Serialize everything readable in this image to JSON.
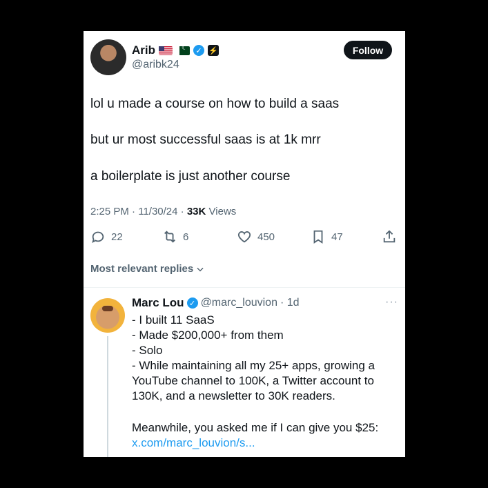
{
  "tweet": {
    "author_name": "Arib",
    "author_handle": "@aribk24",
    "follow_label": "Follow",
    "lines": [
      "lol u made a course on how to build a saas",
      "but ur most successful saas is at 1k mrr",
      "a boilerplate is just another course"
    ],
    "time": "2:25 PM",
    "date": "11/30/24",
    "views_count": "33K",
    "views_label": "Views",
    "replies": "22",
    "reposts": "6",
    "likes": "450",
    "bookmarks": "47"
  },
  "replies_section": {
    "label": "Most relevant replies"
  },
  "reply": {
    "author_name": "Marc Lou",
    "author_handle": "@marc_louvion",
    "age": "· 1d",
    "lines": [
      "- I built 11 SaaS",
      "- Made $200,000+ from them",
      "- Solo",
      "- While maintaining all my 25+ apps, growing a",
      "YouTube channel to 100K, a Twitter account to",
      "130K, and a newsletter to 30K readers.",
      "Meanwhile, you asked me if I can give you $25:"
    ],
    "link": "x.com/marc_louvion/s..."
  },
  "colors": {
    "accent": "#1d9bf0",
    "text": "#0f1419",
    "muted": "#536471",
    "background": "#000000"
  },
  "icons": [
    "reply-icon",
    "repost-icon",
    "like-icon",
    "bookmark-icon",
    "share-icon",
    "chevron-down-icon",
    "verified-icon",
    "more-icon"
  ]
}
